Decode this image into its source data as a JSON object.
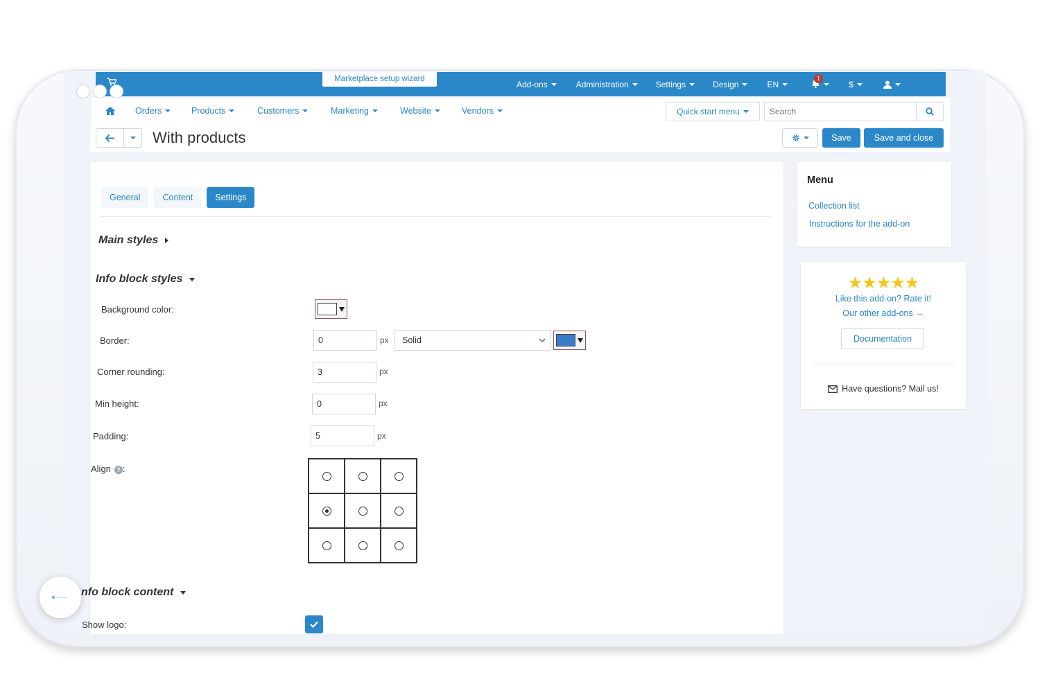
{
  "topbar": {
    "wizard": "Marketplace setup wizard",
    "menus": [
      "Add-ons",
      "Administration",
      "Settings",
      "Design",
      "EN"
    ],
    "notification_count": "1",
    "currency": "$"
  },
  "nav": {
    "items": [
      "Orders",
      "Products",
      "Customers",
      "Marketing",
      "Website",
      "Vendors"
    ],
    "quick_start": "Quick start menu",
    "search_placeholder": "Search"
  },
  "title": {
    "text": "With products",
    "save": "Save",
    "save_close": "Save and close"
  },
  "tabs": [
    "General",
    "Content",
    "Settings"
  ],
  "active_tab": "Settings",
  "sections": {
    "main_styles": "Main styles",
    "info_block_styles": "Info block styles",
    "info_block_content": "nfo block content"
  },
  "form": {
    "background_color_label": "Background color:",
    "background_color": "#ffffff",
    "border_label": "Border:",
    "border_value": "0",
    "border_unit": "px",
    "border_style": "Solid",
    "border_color": "#3a7bc8",
    "corner_label": "Corner rounding:",
    "corner_value": "3",
    "corner_unit": "px",
    "min_height_label": "Min height:",
    "min_height_value": "0",
    "min_height_unit": "px",
    "padding_label": "Padding:",
    "padding_value": "5",
    "padding_unit": "px",
    "align_label": "Align",
    "align_suffix": ":",
    "align_selected": "middle-left",
    "show_logo_label": "Show logo:",
    "show_logo": true
  },
  "sidebar": {
    "menu_title": "Menu",
    "links": [
      "Collection list",
      "Instructions for the add-on"
    ],
    "rate": "Like this add-on? Rate it!",
    "other": "Our other add-ons →",
    "documentation": "Documentation",
    "mail": "Have questions? Mail us!",
    "stars": "★★★★★"
  },
  "colors": {
    "accent": "#2a88c9",
    "star": "#f5c518"
  }
}
